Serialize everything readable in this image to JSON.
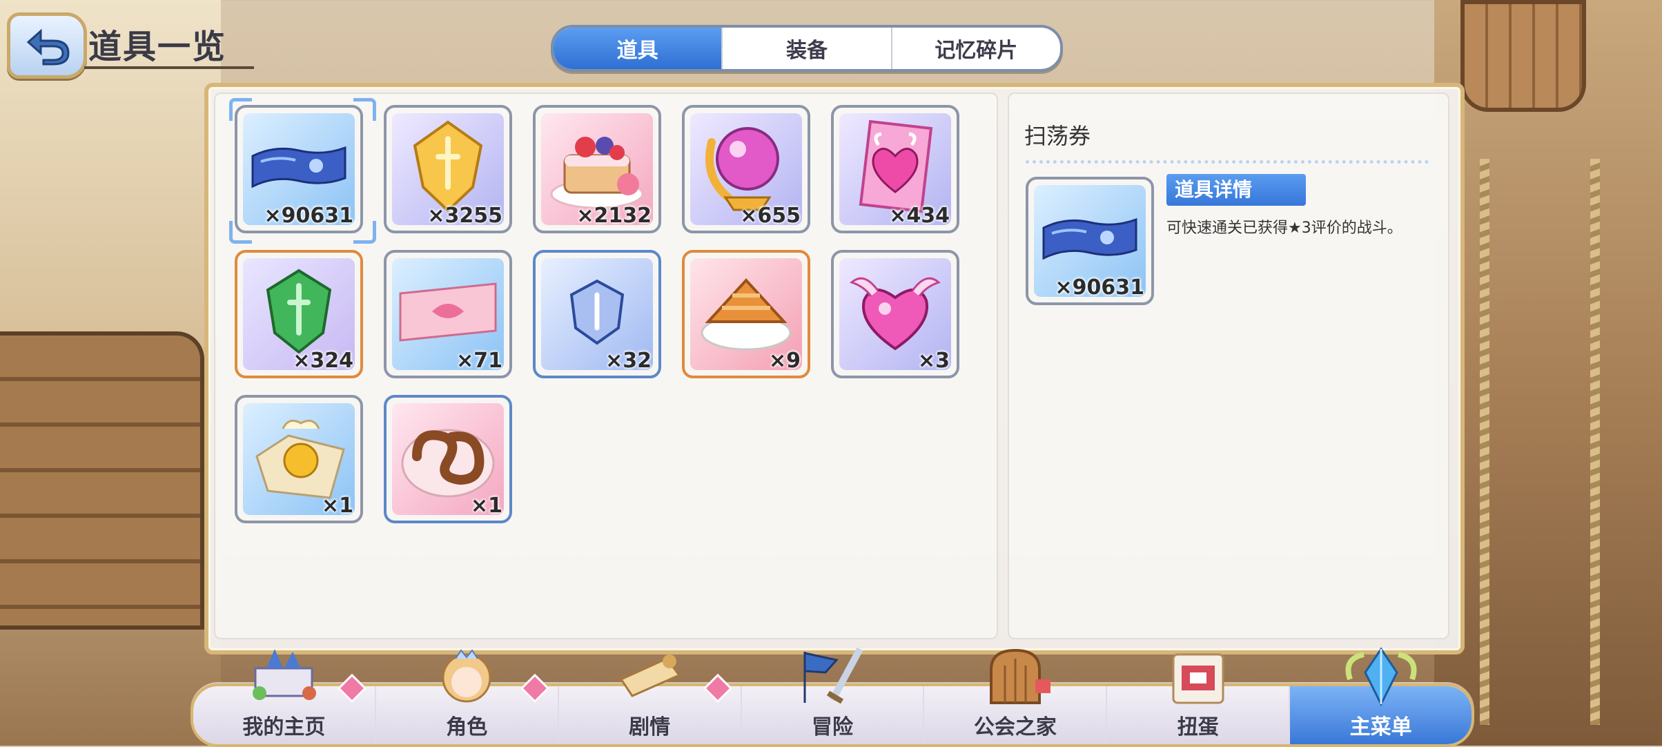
{
  "header": {
    "title": "道具一览"
  },
  "tabs": [
    {
      "label": "道具",
      "active": true
    },
    {
      "label": "装备",
      "active": false
    },
    {
      "label": "记忆碎片",
      "active": false
    }
  ],
  "items": [
    {
      "name": "sweep-ticket",
      "qty": "×90631",
      "icon": "ticket-icon",
      "selected": true
    },
    {
      "name": "gold-crest",
      "qty": "×3255",
      "icon": "gold-crest-icon"
    },
    {
      "name": "berry-cake",
      "qty": "×2132",
      "icon": "cake-icon"
    },
    {
      "name": "pink-orb",
      "qty": "×655",
      "icon": "orb-icon"
    },
    {
      "name": "heart-card",
      "qty": "×434",
      "icon": "heart-card-icon"
    },
    {
      "name": "green-shield",
      "qty": "×324",
      "icon": "green-shield-icon"
    },
    {
      "name": "pink-ticket",
      "qty": "×71",
      "icon": "pink-ticket-icon"
    },
    {
      "name": "blue-shield",
      "qty": "×32",
      "icon": "blue-shield-icon"
    },
    {
      "name": "apple-pie",
      "qty": "×9",
      "icon": "pie-icon"
    },
    {
      "name": "winged-heart",
      "qty": "×3",
      "icon": "winged-heart-icon"
    },
    {
      "name": "candy",
      "qty": "×1",
      "icon": "candy-icon"
    },
    {
      "name": "pretzel",
      "qty": "×1",
      "icon": "pretzel-icon"
    }
  ],
  "detail": {
    "name": "扫荡券",
    "qty": "×90631",
    "label": "道具详情",
    "description": "可快速通关已获得★3评价的战斗。"
  },
  "nav": [
    {
      "label": "我的主页",
      "icon": "castle-icon",
      "badge": true
    },
    {
      "label": "角色",
      "icon": "character-icon",
      "badge": true
    },
    {
      "label": "剧情",
      "icon": "scroll-icon",
      "badge": true
    },
    {
      "label": "冒险",
      "icon": "flag-sword-icon",
      "badge": false
    },
    {
      "label": "公会之家",
      "icon": "door-icon",
      "badge": false
    },
    {
      "label": "扭蛋",
      "icon": "gacha-icon",
      "badge": false
    },
    {
      "label": "主菜单",
      "icon": "crystal-icon",
      "badge": false,
      "active": true
    }
  ]
}
